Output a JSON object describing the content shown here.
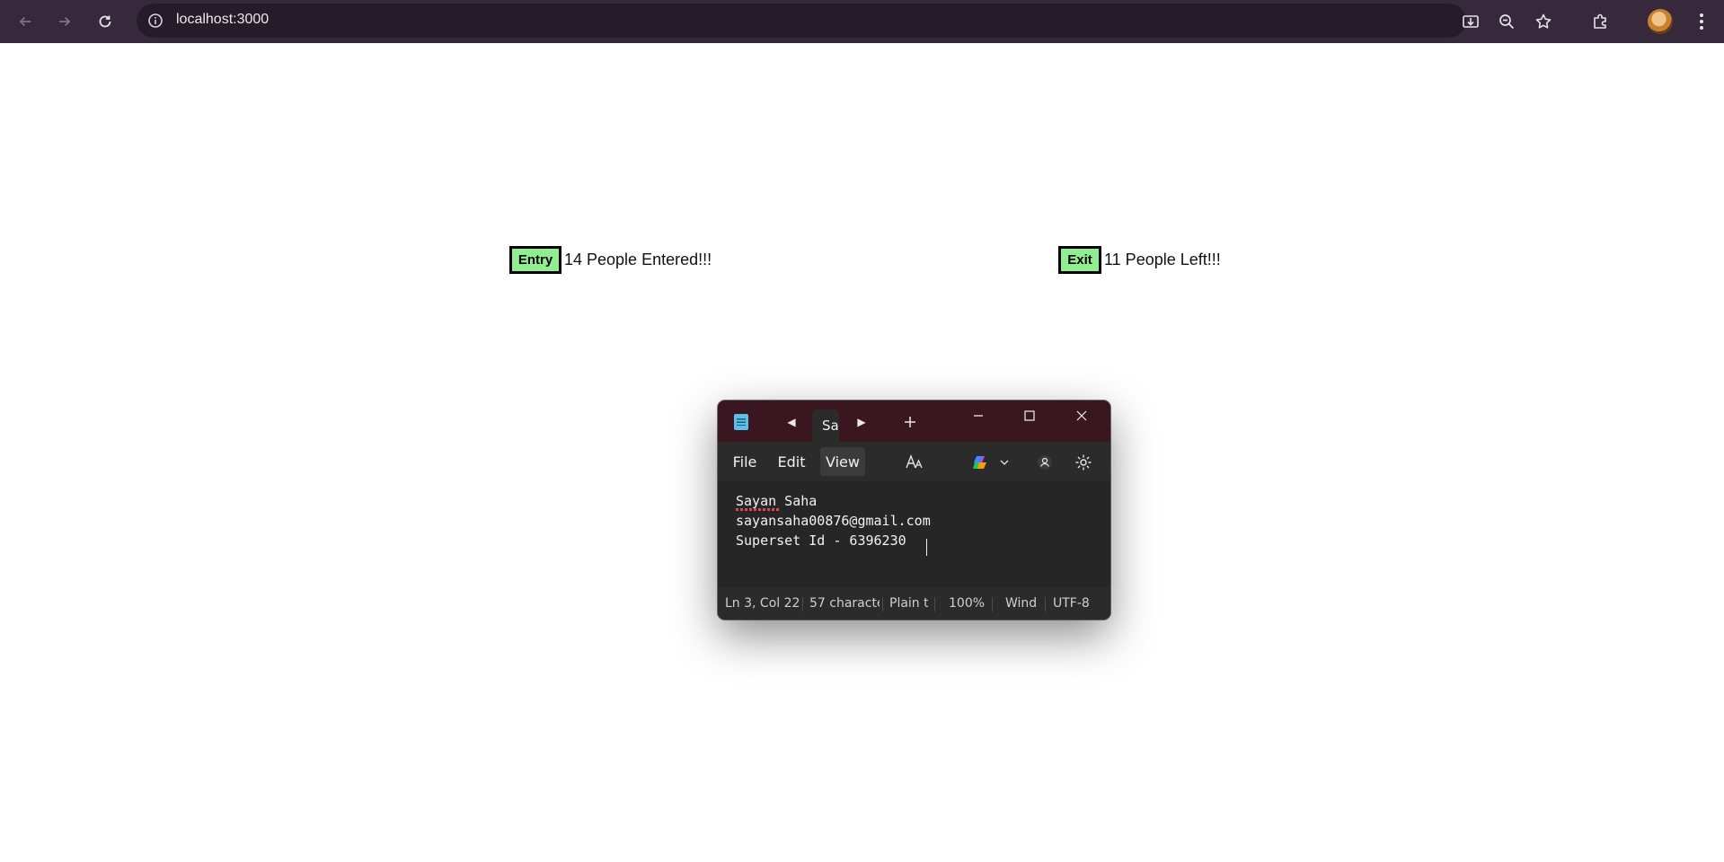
{
  "browser": {
    "url": "localhost:3000",
    "icons": {
      "back": "arrow-left",
      "forward": "arrow-right",
      "reload": "reload",
      "site_info": "info-circle",
      "install": "install-app",
      "zoom": "magnifier-minus",
      "bookmark": "star",
      "extensions": "puzzle",
      "profile": "avatar",
      "menu": "three-dots"
    }
  },
  "page": {
    "entry": {
      "button_label": "Entry",
      "message": "14 People Entered!!!"
    },
    "exit": {
      "button_label": "Exit",
      "message": "11 People Left!!!"
    },
    "button_color": "#90ee90"
  },
  "notepad": {
    "tab_title": "Say",
    "menu": {
      "file": "File",
      "edit": "Edit",
      "view": "View"
    },
    "content": {
      "line1": "Sayan Saha",
      "line2": "sayansaha00876@gmail.com",
      "line3": "Superset Id - 6396230"
    },
    "status": {
      "position": "Ln 3, Col 22",
      "characters": "57 characte",
      "format": "Plain te",
      "zoom": "100%",
      "line_ending": "Wind",
      "encoding": "UTF-8"
    },
    "colors": {
      "titlebar": "#3a1620",
      "background": "#202020"
    }
  }
}
